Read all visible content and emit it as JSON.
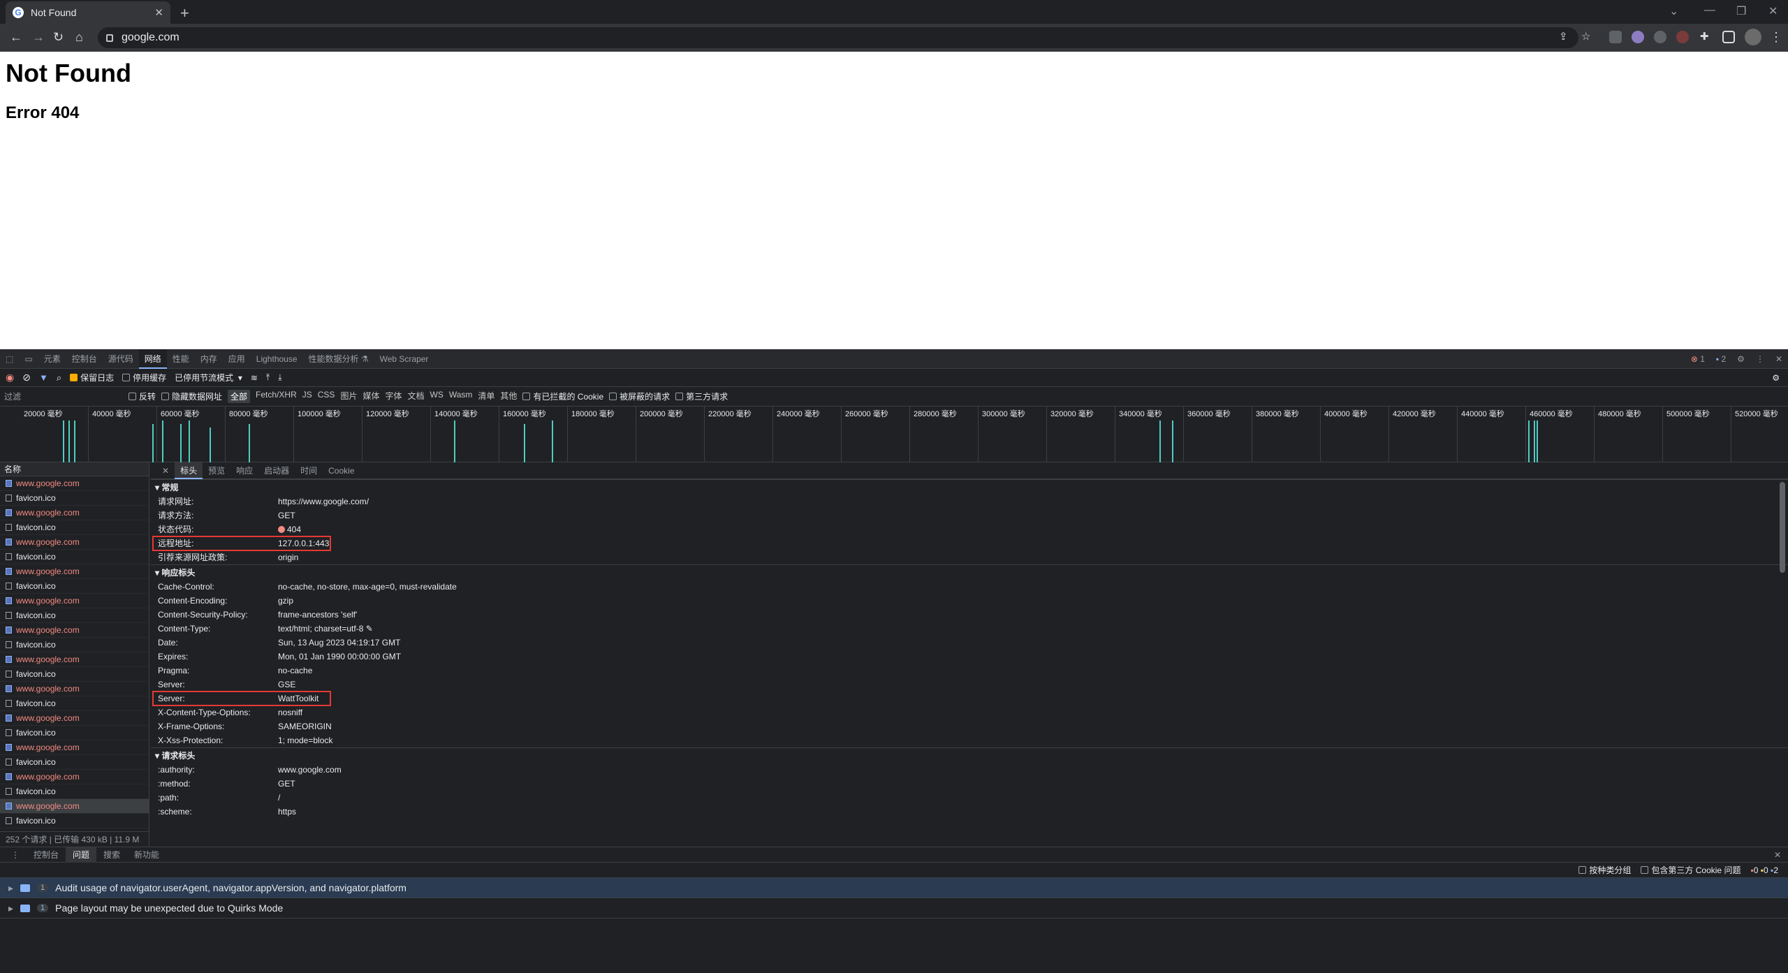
{
  "browser": {
    "tab_title": "Not Found",
    "tab_favicon": "G",
    "tab_close": "✕",
    "new_tab": "+",
    "url": "google.com"
  },
  "page": {
    "heading": "Not Found",
    "subheading": "Error 404"
  },
  "devtools": {
    "tabs": [
      "元素",
      "控制台",
      "源代码",
      "网络",
      "性能",
      "内存",
      "应用",
      "Lighthouse",
      "性能数据分析 ⚗",
      "Web Scraper"
    ],
    "active_tab": "网络",
    "error_count": "1",
    "message_count": "2",
    "toolbar": {
      "preserve_log": "保留日志",
      "disable_cache": "停用缓存",
      "throttle": "已停用节流模式"
    },
    "filter": {
      "placeholder": "过滤",
      "invert": "反转",
      "hide_data_urls": "隐藏数据网址",
      "types": [
        "全部",
        "Fetch/XHR",
        "JS",
        "CSS",
        "图片",
        "媒体",
        "字体",
        "文档",
        "WS",
        "Wasm",
        "清单",
        "其他"
      ],
      "active_type": "全部",
      "blocked_cookies": "有已拦截的 Cookie",
      "blocked_requests": "被屏蔽的请求",
      "third_party": "第三方请求"
    },
    "timeline_ticks": [
      "20000 毫秒",
      "40000 毫秒",
      "60000 毫秒",
      "80000 毫秒",
      "100000 毫秒",
      "120000 毫秒",
      "140000 毫秒",
      "160000 毫秒",
      "180000 毫秒",
      "200000 毫秒",
      "220000 毫秒",
      "240000 毫秒",
      "260000 毫秒",
      "280000 毫秒",
      "300000 毫秒",
      "320000 毫秒",
      "340000 毫秒",
      "360000 毫秒",
      "380000 毫秒",
      "400000 毫秒",
      "420000 毫秒",
      "440000 毫秒",
      "460000 毫秒",
      "480000 毫秒",
      "500000 毫秒",
      "520000 毫秒"
    ],
    "request_list": {
      "header": "名称",
      "rows": [
        {
          "name": "www.google.com",
          "type": "doc",
          "error": true
        },
        {
          "name": "favicon.ico",
          "type": "other",
          "error": false
        },
        {
          "name": "www.google.com",
          "type": "doc",
          "error": true
        },
        {
          "name": "favicon.ico",
          "type": "other",
          "error": false
        },
        {
          "name": "www.google.com",
          "type": "doc",
          "error": true
        },
        {
          "name": "favicon.ico",
          "type": "other",
          "error": false
        },
        {
          "name": "www.google.com",
          "type": "doc",
          "error": true
        },
        {
          "name": "favicon.ico",
          "type": "other",
          "error": false
        },
        {
          "name": "www.google.com",
          "type": "doc",
          "error": true
        },
        {
          "name": "favicon.ico",
          "type": "other",
          "error": false
        },
        {
          "name": "www.google.com",
          "type": "doc",
          "error": true
        },
        {
          "name": "favicon.ico",
          "type": "other",
          "error": false
        },
        {
          "name": "www.google.com",
          "type": "doc",
          "error": true
        },
        {
          "name": "favicon.ico",
          "type": "other",
          "error": false
        },
        {
          "name": "www.google.com",
          "type": "doc",
          "error": true
        },
        {
          "name": "favicon.ico",
          "type": "other",
          "error": false
        },
        {
          "name": "www.google.com",
          "type": "doc",
          "error": true
        },
        {
          "name": "favicon.ico",
          "type": "other",
          "error": false
        },
        {
          "name": "www.google.com",
          "type": "doc",
          "error": true
        },
        {
          "name": "favicon.ico",
          "type": "other",
          "error": false
        },
        {
          "name": "www.google.com",
          "type": "doc",
          "error": true
        },
        {
          "name": "favicon.ico",
          "type": "other",
          "error": false
        },
        {
          "name": "www.google.com",
          "type": "doc",
          "error": true,
          "selected": true
        },
        {
          "name": "favicon.ico",
          "type": "other",
          "error": false
        }
      ],
      "status": "252 个请求  |  已传输 430 kB  |  11.9 M"
    },
    "detail": {
      "tabs": [
        "标头",
        "预览",
        "响应",
        "启动器",
        "时间",
        "Cookie"
      ],
      "active_tab": "标头",
      "general_title": "常规",
      "general": [
        {
          "k": "请求网址:",
          "v": "https://www.google.com/"
        },
        {
          "k": "请求方法:",
          "v": "GET"
        },
        {
          "k": "状态代码:",
          "v": "404",
          "dot": true
        },
        {
          "k": "远程地址:",
          "v": "127.0.0.1:443",
          "highlight": true
        },
        {
          "k": "引荐来源网址政策:",
          "v": "origin"
        }
      ],
      "response_title": "响应标头",
      "response_headers": [
        {
          "k": "Cache-Control:",
          "v": "no-cache, no-store, max-age=0, must-revalidate"
        },
        {
          "k": "Content-Encoding:",
          "v": "gzip"
        },
        {
          "k": "Content-Security-Policy:",
          "v": "frame-ancestors 'self'"
        },
        {
          "k": "Content-Type:",
          "v": "text/html; charset=utf-8 ✎"
        },
        {
          "k": "Date:",
          "v": "Sun, 13 Aug 2023 04:19:17 GMT"
        },
        {
          "k": "Expires:",
          "v": "Mon, 01 Jan 1990 00:00:00 GMT"
        },
        {
          "k": "Pragma:",
          "v": "no-cache"
        },
        {
          "k": "Server:",
          "v": "GSE"
        },
        {
          "k": "Server:",
          "v": "WattToolkit",
          "highlight": true
        },
        {
          "k": "X-Content-Type-Options:",
          "v": "nosniff"
        },
        {
          "k": "X-Frame-Options:",
          "v": "SAMEORIGIN"
        },
        {
          "k": "X-Xss-Protection:",
          "v": "1; mode=block"
        }
      ],
      "request_title": "请求标头",
      "request_headers": [
        {
          "k": ":authority:",
          "v": "www.google.com"
        },
        {
          "k": ":method:",
          "v": "GET"
        },
        {
          "k": ":path:",
          "v": "/"
        },
        {
          "k": ":scheme:",
          "v": "https"
        }
      ]
    },
    "drawer": {
      "tabs": [
        "控制台",
        "问题",
        "搜索",
        "新功能"
      ],
      "active_tab": "问题",
      "group_by_kind": "按种类分组",
      "include_third_party": "包含第三方 Cookie 问题",
      "counts": {
        "errors": "0",
        "warnings": "0",
        "info": "2"
      },
      "issues": [
        {
          "count": "1",
          "text": "Audit usage of navigator.userAgent, navigator.appVersion, and navigator.platform"
        },
        {
          "count": "1",
          "text": "Page layout may be unexpected due to Quirks Mode"
        }
      ]
    }
  }
}
